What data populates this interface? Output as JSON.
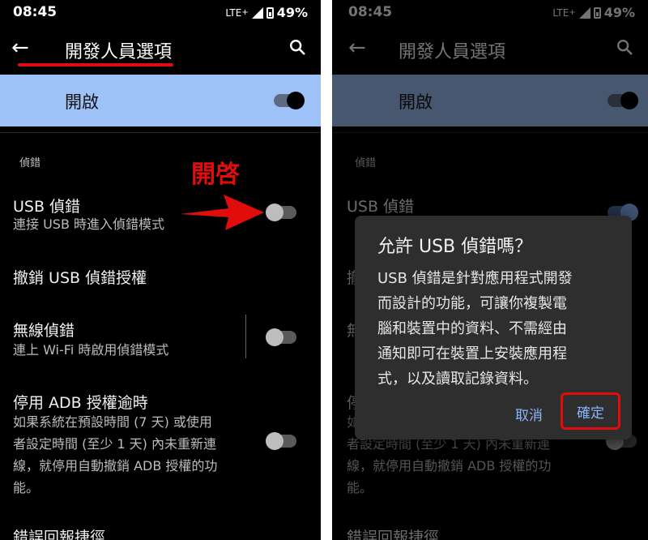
{
  "status_bar": {
    "time": "08:45",
    "network": "LTE",
    "network_plus": "+",
    "battery": "49%"
  },
  "toolbar": {
    "title": "開發人員選項"
  },
  "master_switch": {
    "label": "開啟",
    "state": "on"
  },
  "section_header": "偵錯",
  "annotation_label": "開啓",
  "settings": {
    "usb_debugging": {
      "title": "USB 偵錯",
      "summary": "連接 USB 時進入偵錯模式",
      "state": "off"
    },
    "revoke_usb": {
      "title": "撤銷 USB 偵錯授權"
    },
    "wireless_debugging": {
      "title": "無線偵錯",
      "summary": "連上 Wi-Fi 時啟用偵錯模式",
      "state": "off"
    },
    "adb_timeout": {
      "title": "停用 ADB 授權逾時",
      "summary_lines": [
        "如果系統在預設時間 (7 天) 或使用",
        "者設定時間 (至少 1 天) 內未重新連",
        "線，就停用自動撤銷 ADB 授權的功",
        "能。"
      ],
      "state": "off"
    },
    "bug_report": {
      "title": "錯誤回報捷徑"
    }
  },
  "dialog": {
    "title": "允許 USB 偵錯嗎？",
    "message_lines": [
      "USB 偵錯是針對應用程式開發",
      "而設計的功能，可讓你複製電",
      "腦和裝置中的資料、不需經由",
      "通知即可在裝置上安裝應用程",
      "式，以及讀取記錄資料。"
    ],
    "cancel_label": "取消",
    "ok_label": "確定"
  },
  "colors": {
    "highlight": "#9ec2f7",
    "annotation": "#e10c0c",
    "accent": "#8ab4f8"
  }
}
